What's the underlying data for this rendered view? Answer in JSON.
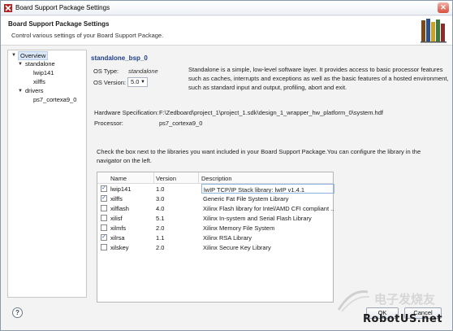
{
  "window": {
    "title": "Board Support Package Settings",
    "close_label": "✕"
  },
  "header": {
    "title": "Board Support Package Settings",
    "description": "Control various settings of your Board Support Package."
  },
  "nav": {
    "overview": "Overview",
    "standalone": "standalone",
    "lwip141": "lwip141",
    "xilffs": "xilffs",
    "drivers": "drivers",
    "ps7": "ps7_cortexa9_0"
  },
  "main": {
    "bsp_name": "standalone_bsp_0",
    "os_type_label": "OS Type:",
    "os_type_value": "standalone",
    "os_version_label": "OS Version:",
    "os_version_value": "5.0",
    "description": "Standalone is a simple, low-level software layer. It provides access to basic processor features such as caches, interrupts and exceptions as well as the basic features of a hosted environment, such as standard input and output, profiling, abort and exit.",
    "hw_spec_label": "Hardware Specification:",
    "hw_spec_value": "F:\\Zedboard\\project_1\\project_1.sdk\\design_1_wrapper_hw_platform_0\\system.hdf",
    "processor_label": "Processor:",
    "processor_value": "ps7_cortexa9_0",
    "instructions_line1": "Check the box next to the libraries you want included in your Board Support Package.You can configure the library in the",
    "instructions_line2": "navigator on the left."
  },
  "table": {
    "headers": {
      "name": "Name",
      "version": "Version",
      "description": "Description"
    },
    "rows": [
      {
        "checked": true,
        "name": "lwip141",
        "version": "1.0",
        "description": "lwIP TCP/IP Stack library: lwIP v1.4.1"
      },
      {
        "checked": true,
        "name": "xilffs",
        "version": "3.0",
        "description": "Generic Fat File System Library"
      },
      {
        "checked": false,
        "name": "xilflash",
        "version": "4.0",
        "description": "Xilinx Flash library for Intel/AMD CFI compliant ..."
      },
      {
        "checked": false,
        "name": "xilisf",
        "version": "5.1",
        "description": "Xilinx In-system and Serial Flash Library"
      },
      {
        "checked": false,
        "name": "xilmfs",
        "version": "2.0",
        "description": "Xilinx Memory File System"
      },
      {
        "checked": true,
        "name": "xilrsa",
        "version": "1.1",
        "description": "Xilinx RSA Library"
      },
      {
        "checked": false,
        "name": "xilskey",
        "version": "2.0",
        "description": "Xilinx Secure Key Library"
      }
    ]
  },
  "footer": {
    "help": "?",
    "ok": "OK",
    "cancel": "Cancel"
  },
  "watermark": {
    "cn": "电子发烧友",
    "en": "RobotUS.net"
  }
}
